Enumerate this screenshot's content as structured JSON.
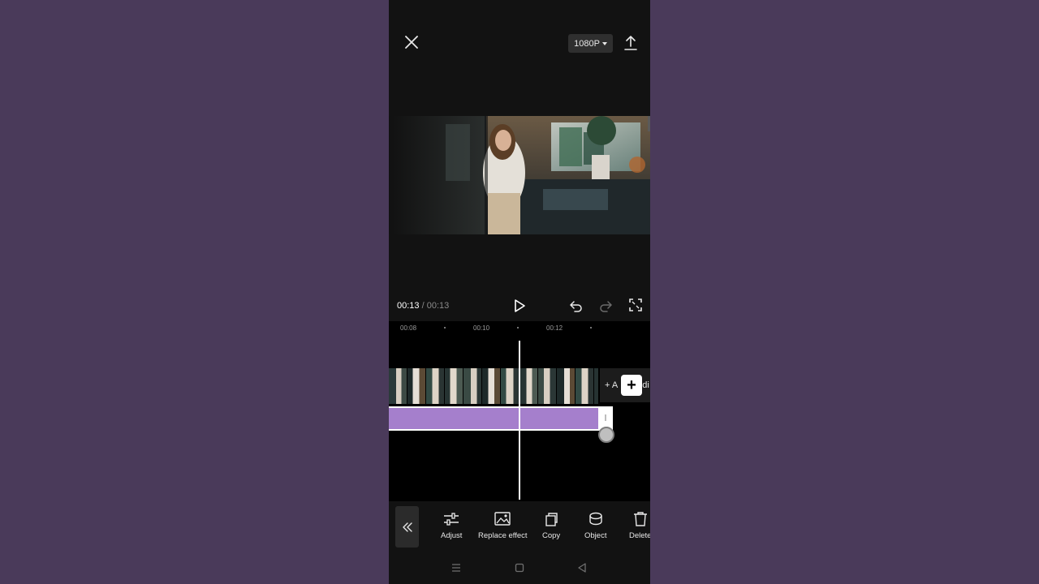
{
  "top_bar": {
    "close_icon": "close-icon",
    "resolution": "1080P",
    "export_icon": "upload-icon"
  },
  "preview": {
    "description_icon": "video-preview"
  },
  "playback": {
    "current_time": "00:13",
    "separator": "/",
    "total_time": "00:13"
  },
  "ruler": {
    "labels": [
      "00:08",
      "00:10",
      "00:12"
    ]
  },
  "timeline": {
    "add_audio_label": "+ A",
    "add_audio_suffix": "di"
  },
  "toolbar": {
    "items": [
      {
        "label": "Adjust",
        "icon": "sliders-icon"
      },
      {
        "label": "Replace effect",
        "icon": "replace-image-icon"
      },
      {
        "label": "Copy",
        "icon": "copy-icon"
      },
      {
        "label": "Object",
        "icon": "object-icon"
      },
      {
        "label": "Delete",
        "icon": "trash-icon"
      }
    ]
  },
  "colors": {
    "background": "#4a3a5a",
    "app_bg": "#121212",
    "effect_track": "#a57fcc",
    "timeline_bg": "#000000"
  }
}
